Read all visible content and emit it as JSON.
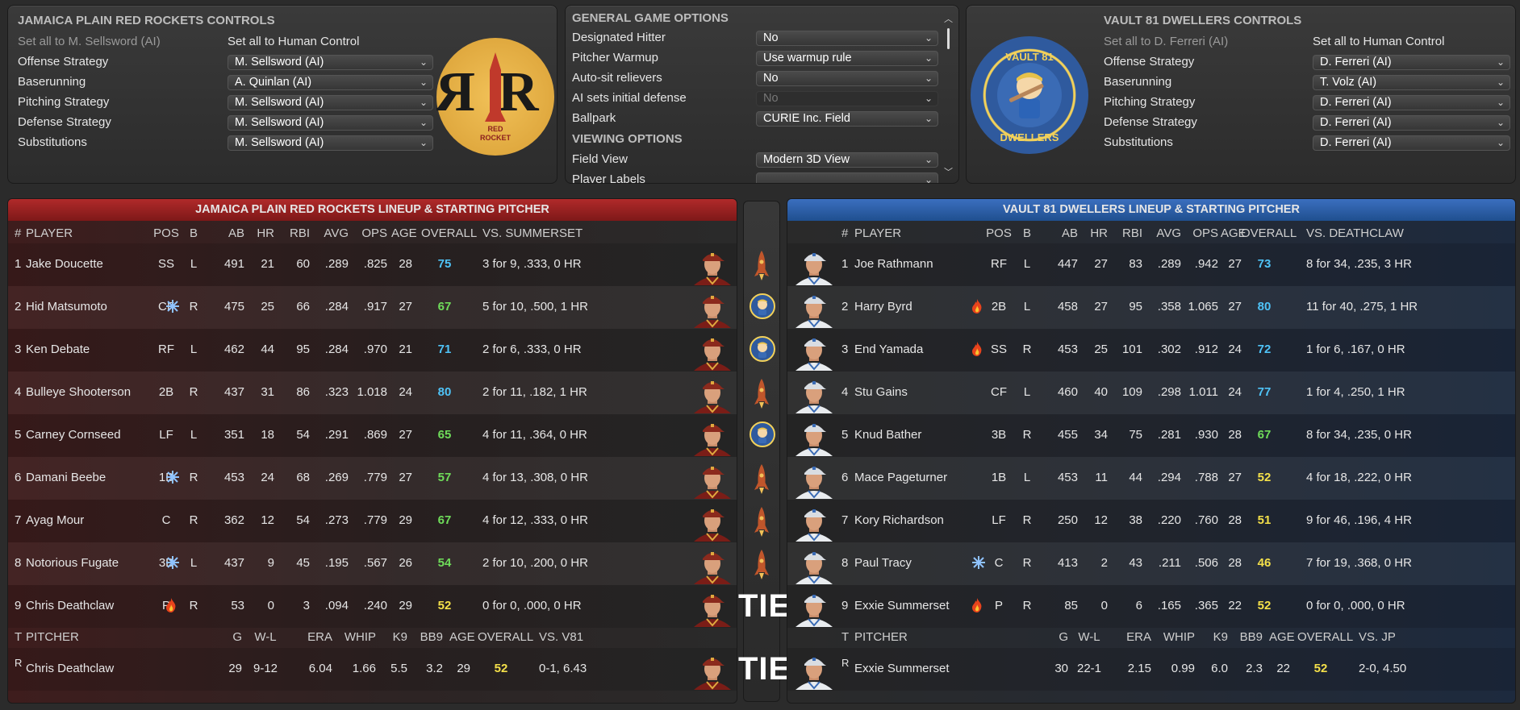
{
  "left_controls": {
    "title": "JAMAICA PLAIN RED ROCKETS CONTROLS",
    "set_ai": "Set all to M. Sellsword (AI)",
    "set_human": "Set all to Human Control",
    "rows": [
      {
        "label": "Offense Strategy",
        "value": "M. Sellsword (AI)"
      },
      {
        "label": "Baserunning",
        "value": "A. Quinlan (AI)"
      },
      {
        "label": "Pitching Strategy",
        "value": "M. Sellsword (AI)"
      },
      {
        "label": "Defense Strategy",
        "value": "M. Sellsword (AI)"
      },
      {
        "label": "Substitutions",
        "value": "M. Sellsword (AI)"
      }
    ],
    "logo_text": "RED ROCKET"
  },
  "game_options": {
    "title": "GENERAL GAME OPTIONS",
    "rows": [
      {
        "label": "Designated Hitter",
        "value": "No"
      },
      {
        "label": "Pitcher Warmup",
        "value": "Use warmup rule"
      },
      {
        "label": "Auto-sit relievers",
        "value": "No"
      },
      {
        "label": "AI sets initial defense",
        "value": "No"
      },
      {
        "label": "Ballpark",
        "value": "CURIE Inc. Field"
      }
    ],
    "viewing_title": "VIEWING OPTIONS",
    "view_rows": [
      {
        "label": "Field View",
        "value": "Modern 3D View"
      },
      {
        "label": "Player Labels",
        "value": ""
      }
    ]
  },
  "right_controls": {
    "title": "VAULT 81 DWELLERS CONTROLS",
    "set_ai": "Set all to D. Ferreri (AI)",
    "set_human": "Set all to Human Control",
    "rows": [
      {
        "label": "Offense Strategy",
        "value": "D. Ferreri (AI)"
      },
      {
        "label": "Baserunning",
        "value": "T. Volz (AI)"
      },
      {
        "label": "Pitching Strategy",
        "value": "D. Ferreri (AI)"
      },
      {
        "label": "Defense Strategy",
        "value": "D. Ferreri (AI)"
      },
      {
        "label": "Substitutions",
        "value": "D. Ferreri (AI)"
      }
    ],
    "logo_text": "VAULT 81 DWELLERS"
  },
  "left_lineup": {
    "title": "JAMAICA PLAIN RED ROCKETS LINEUP & STARTING PITCHER",
    "headers": {
      "num": "#",
      "player": "PLAYER",
      "pos": "POS",
      "b": "B",
      "ab": "AB",
      "hr": "HR",
      "rbi": "RBI",
      "avg": "AVG",
      "ops": "OPS",
      "age": "AGE",
      "overall": "OVERALL",
      "vs": "VS. SUMMERSET"
    },
    "players": [
      {
        "n": "1",
        "name": "Jake Doucette",
        "icon": "",
        "pos": "SS",
        "b": "L",
        "ab": "491",
        "hr": "21",
        "rbi": "60",
        "avg": ".289",
        "ops": ".825",
        "age": "28",
        "ovr": "75",
        "ovc": "ov-blue",
        "vs": "3 for 9, .333, 0 HR"
      },
      {
        "n": "2",
        "name": "Hid Matsumoto",
        "icon": "ice",
        "pos": "CF",
        "b": "R",
        "ab": "475",
        "hr": "25",
        "rbi": "66",
        "avg": ".284",
        "ops": ".917",
        "age": "27",
        "ovr": "67",
        "ovc": "ov-green",
        "vs": "5 for 10, .500, 1 HR"
      },
      {
        "n": "3",
        "name": "Ken Debate",
        "icon": "",
        "pos": "RF",
        "b": "L",
        "ab": "462",
        "hr": "44",
        "rbi": "95",
        "avg": ".284",
        "ops": ".970",
        "age": "21",
        "ovr": "71",
        "ovc": "ov-blue",
        "vs": "2 for 6, .333, 0 HR"
      },
      {
        "n": "4",
        "name": "Bulleye Shooterson",
        "icon": "",
        "pos": "2B",
        "b": "R",
        "ab": "437",
        "hr": "31",
        "rbi": "86",
        "avg": ".323",
        "ops": "1.018",
        "age": "24",
        "ovr": "80",
        "ovc": "ov-blue",
        "vs": "2 for 11, .182, 1 HR"
      },
      {
        "n": "5",
        "name": "Carney Cornseed",
        "icon": "",
        "pos": "LF",
        "b": "L",
        "ab": "351",
        "hr": "18",
        "rbi": "54",
        "avg": ".291",
        "ops": ".869",
        "age": "27",
        "ovr": "65",
        "ovc": "ov-green",
        "vs": "4 for 11, .364, 0 HR"
      },
      {
        "n": "6",
        "name": "Damani Beebe",
        "icon": "ice",
        "pos": "1B",
        "b": "R",
        "ab": "453",
        "hr": "24",
        "rbi": "68",
        "avg": ".269",
        "ops": ".779",
        "age": "27",
        "ovr": "57",
        "ovc": "ov-green",
        "vs": "4 for 13, .308, 0 HR"
      },
      {
        "n": "7",
        "name": "Ayag Mour",
        "icon": "",
        "pos": "C",
        "b": "R",
        "ab": "362",
        "hr": "12",
        "rbi": "54",
        "avg": ".273",
        "ops": ".779",
        "age": "29",
        "ovr": "67",
        "ovc": "ov-green",
        "vs": "4 for 12, .333, 0 HR"
      },
      {
        "n": "8",
        "name": "Notorious Fugate",
        "icon": "ice",
        "pos": "3B",
        "b": "L",
        "ab": "437",
        "hr": "9",
        "rbi": "45",
        "avg": ".195",
        "ops": ".567",
        "age": "26",
        "ovr": "54",
        "ovc": "ov-green",
        "vs": "2 for 10, .200, 0 HR"
      },
      {
        "n": "9",
        "name": "Chris Deathclaw",
        "icon": "fire",
        "pos": "P",
        "b": "R",
        "ab": "53",
        "hr": "0",
        "rbi": "3",
        "avg": ".094",
        "ops": ".240",
        "age": "29",
        "ovr": "52",
        "ovc": "ov-yellow",
        "vs": "0 for 0, .000, 0 HR"
      }
    ],
    "pheaders": {
      "t": "T",
      "pitcher": "PITCHER",
      "g": "G",
      "wl": "W-L",
      "era": "ERA",
      "whip": "WHIP",
      "k9": "K9",
      "bb9": "BB9",
      "age": "AGE",
      "overall": "OVERALL",
      "vs": "VS. V81"
    },
    "pitcher": {
      "t": "R",
      "name": "Chris Deathclaw",
      "g": "29",
      "wl": "9-12",
      "era": "6.04",
      "whip": "1.66",
      "k9": "5.5",
      "bb9": "3.2",
      "age": "29",
      "ovr": "52",
      "vs": "0-1, 6.43"
    }
  },
  "middle": {
    "icons": [
      "rocket",
      "vault",
      "vault",
      "rocket",
      "vault",
      "rocket",
      "rocket",
      "rocket"
    ],
    "tie1": "TIE",
    "tie2": "TIE"
  },
  "right_lineup": {
    "title": "VAULT 81 DWELLERS LINEUP & STARTING PITCHER",
    "headers": {
      "num": "#",
      "player": "PLAYER",
      "pos": "POS",
      "b": "B",
      "ab": "AB",
      "hr": "HR",
      "rbi": "RBI",
      "avg": "AVG",
      "ops": "OPS",
      "age": "AGE",
      "overall": "OVERALL",
      "vs": "VS. DEATHCLAW"
    },
    "players": [
      {
        "n": "1",
        "name": "Joe Rathmann",
        "icon": "",
        "pos": "RF",
        "b": "L",
        "ab": "447",
        "hr": "27",
        "rbi": "83",
        "avg": ".289",
        "ops": ".942",
        "age": "27",
        "ovr": "73",
        "ovc": "ov-blue",
        "vs": "8 for 34, .235, 3 HR"
      },
      {
        "n": "2",
        "name": "Harry Byrd",
        "icon": "fire",
        "pos": "2B",
        "b": "L",
        "ab": "458",
        "hr": "27",
        "rbi": "95",
        "avg": ".358",
        "ops": "1.065",
        "age": "27",
        "ovr": "80",
        "ovc": "ov-blue",
        "vs": "11 for 40, .275, 1 HR"
      },
      {
        "n": "3",
        "name": "End Yamada",
        "icon": "fire",
        "pos": "SS",
        "b": "R",
        "ab": "453",
        "hr": "25",
        "rbi": "101",
        "avg": ".302",
        "ops": ".912",
        "age": "24",
        "ovr": "72",
        "ovc": "ov-blue",
        "vs": "1 for 6, .167, 0 HR"
      },
      {
        "n": "4",
        "name": "Stu Gains",
        "icon": "",
        "pos": "CF",
        "b": "L",
        "ab": "460",
        "hr": "40",
        "rbi": "109",
        "avg": ".298",
        "ops": "1.011",
        "age": "24",
        "ovr": "77",
        "ovc": "ov-blue",
        "vs": "1 for 4, .250, 1 HR"
      },
      {
        "n": "5",
        "name": "Knud Bather",
        "icon": "",
        "pos": "3B",
        "b": "R",
        "ab": "455",
        "hr": "34",
        "rbi": "75",
        "avg": ".281",
        "ops": ".930",
        "age": "28",
        "ovr": "67",
        "ovc": "ov-green",
        "vs": "8 for 34, .235, 0 HR"
      },
      {
        "n": "6",
        "name": "Mace Pageturner",
        "icon": "",
        "pos": "1B",
        "b": "L",
        "ab": "453",
        "hr": "11",
        "rbi": "44",
        "avg": ".294",
        "ops": ".788",
        "age": "27",
        "ovr": "52",
        "ovc": "ov-yellow",
        "vs": "4 for 18, .222, 0 HR"
      },
      {
        "n": "7",
        "name": "Kory Richardson",
        "icon": "",
        "pos": "LF",
        "b": "R",
        "ab": "250",
        "hr": "12",
        "rbi": "38",
        "avg": ".220",
        "ops": ".760",
        "age": "28",
        "ovr": "51",
        "ovc": "ov-yellow",
        "vs": "9 for 46, .196, 4 HR"
      },
      {
        "n": "8",
        "name": "Paul Tracy",
        "icon": "ice",
        "pos": "C",
        "b": "R",
        "ab": "413",
        "hr": "2",
        "rbi": "43",
        "avg": ".211",
        "ops": ".506",
        "age": "28",
        "ovr": "46",
        "ovc": "ov-yellow",
        "vs": "7 for 19, .368, 0 HR"
      },
      {
        "n": "9",
        "name": "Exxie Summerset",
        "icon": "fire",
        "pos": "P",
        "b": "R",
        "ab": "85",
        "hr": "0",
        "rbi": "6",
        "avg": ".165",
        "ops": ".365",
        "age": "22",
        "ovr": "52",
        "ovc": "ov-yellow",
        "vs": "0 for 0, .000, 0 HR"
      }
    ],
    "pheaders": {
      "t": "T",
      "pitcher": "PITCHER",
      "g": "G",
      "wl": "W-L",
      "era": "ERA",
      "whip": "WHIP",
      "k9": "K9",
      "bb9": "BB9",
      "age": "AGE",
      "overall": "OVERALL",
      "vs": "VS. JP"
    },
    "pitcher": {
      "t": "R",
      "name": "Exxie Summerset",
      "g": "30",
      "wl": "22-1",
      "era": "2.15",
      "whip": "0.99",
      "k9": "6.0",
      "bb9": "2.3",
      "age": "22",
      "ovr": "52",
      "vs": "2-0, 4.50"
    }
  },
  "colors": {
    "red_header": "#8a1c1c",
    "blue_header": "#1f4f8f",
    "ovr_blue": "#4fc3f7",
    "ovr_green": "#6fdc5a",
    "ovr_yellow": "#f4e04a"
  }
}
